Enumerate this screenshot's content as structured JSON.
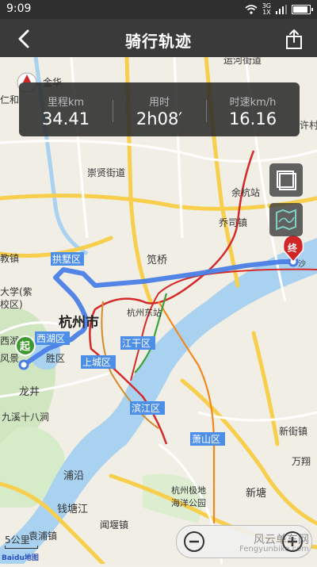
{
  "status_bar": {
    "time": "9:09",
    "network_top": "3G",
    "network_bottom": "1X"
  },
  "header": {
    "title": "骑行轨迹"
  },
  "stats": [
    {
      "label": "里程km",
      "value": "34.41"
    },
    {
      "label": "用时",
      "value": "2h08′"
    },
    {
      "label": "时速km/h",
      "value": "16.16"
    }
  ],
  "markers": {
    "start": "起",
    "end": "终"
  },
  "map_labels": {
    "yunhe": "运河街道",
    "jinhua": "金华",
    "renhe": "仁和",
    "xuxiang": "许村",
    "chongxian": "崇贤街道",
    "yuhang": "余杭",
    "yuhang_station": "余杭站",
    "qiaosi": "乔司镇",
    "gongshu": "拱墅区",
    "bianqiao": "笕桥",
    "jiaozhen": "教镇",
    "daxue": "大学(紫",
    "xiaoqu": "校区)",
    "hangzhou": "杭州市",
    "hangzhou_east": "杭州东站",
    "xihu_lake": "西湖",
    "xihu_district": "西湖区",
    "fengjing": "风景",
    "shengqu": "胜区",
    "jianggan": "江干区",
    "shangcheng": "上城区",
    "longjing": "龙井",
    "jiuxi": "九溪十八涧",
    "binjiang": "滨江区",
    "xiaoshan": "萧山区",
    "xinjie": "新街镇",
    "wanxiang": "万翔",
    "puyan": "浦沿",
    "jidi1": "杭州极地",
    "jidi2": "海洋公园",
    "xintang": "新塘",
    "qiantangjiang": "钱塘江",
    "wenyan": "闻堰镇",
    "yuanpu": "袁浦镇",
    "sha": "沙"
  },
  "scale": {
    "label": "5公里"
  },
  "logo": "Baidu地图",
  "watermark": {
    "line1": "风云单车网",
    "line2": "Fengyunbike.com"
  },
  "icons": [
    "back-arrow-icon",
    "share-icon",
    "layers-icon",
    "map-icon",
    "zoom-out-icon",
    "zoom-in-icon",
    "compass-icon"
  ]
}
